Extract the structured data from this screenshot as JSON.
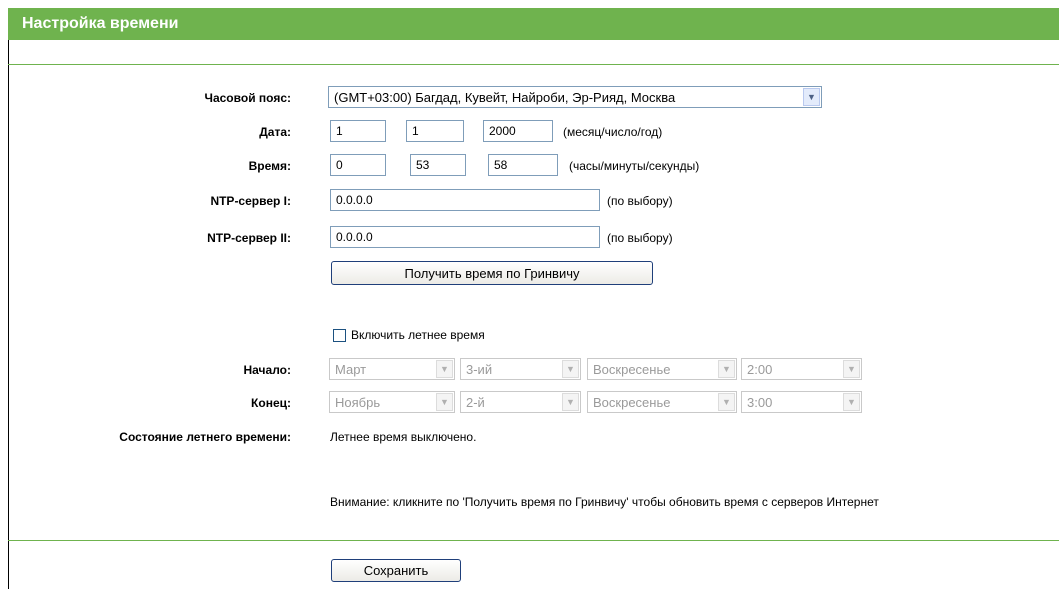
{
  "title": "Настройка времени",
  "timezone": {
    "label": "Часовой пояс:",
    "value": "(GMT+03:00) Багдад, Кувейт, Найроби, Эр-Рияд, Москва"
  },
  "date": {
    "label": "Дата:",
    "month": "1",
    "day": "1",
    "year": "2000",
    "hint": "(месяц/число/год)"
  },
  "time": {
    "label": "Время:",
    "hours": "0",
    "minutes": "53",
    "seconds": "58",
    "hint": "(часы/минуты/секунды)"
  },
  "ntp1": {
    "label": "NTP-сервер I:",
    "value": "0.0.0.0",
    "hint": "(по выбору)"
  },
  "ntp2": {
    "label": "NTP-сервер II:",
    "value": "0.0.0.0",
    "hint": "(по выбору)"
  },
  "get_gmt_button": "Получить время по Гринвичу",
  "dst": {
    "enable_label": "Включить летнее время",
    "enabled": false,
    "start_label": "Начало:",
    "start": {
      "month": "Март",
      "week": "3-ий",
      "day": "Воскресенье",
      "time": "2:00"
    },
    "end_label": "Конец:",
    "end": {
      "month": "Ноябрь",
      "week": "2-й",
      "day": "Воскресенье",
      "time": "3:00"
    },
    "status_label": "Состояние летнего времени:",
    "status_value": "Летнее время выключено."
  },
  "notice": "Внимание: кликните по 'Получить время по Гринвичу' чтобы обновить время с серверов Интернет",
  "save_button": "Сохранить",
  "colors": {
    "header": "#6fb34e",
    "input_border": "#7f9db9",
    "button_border": "#1f3f7a"
  }
}
